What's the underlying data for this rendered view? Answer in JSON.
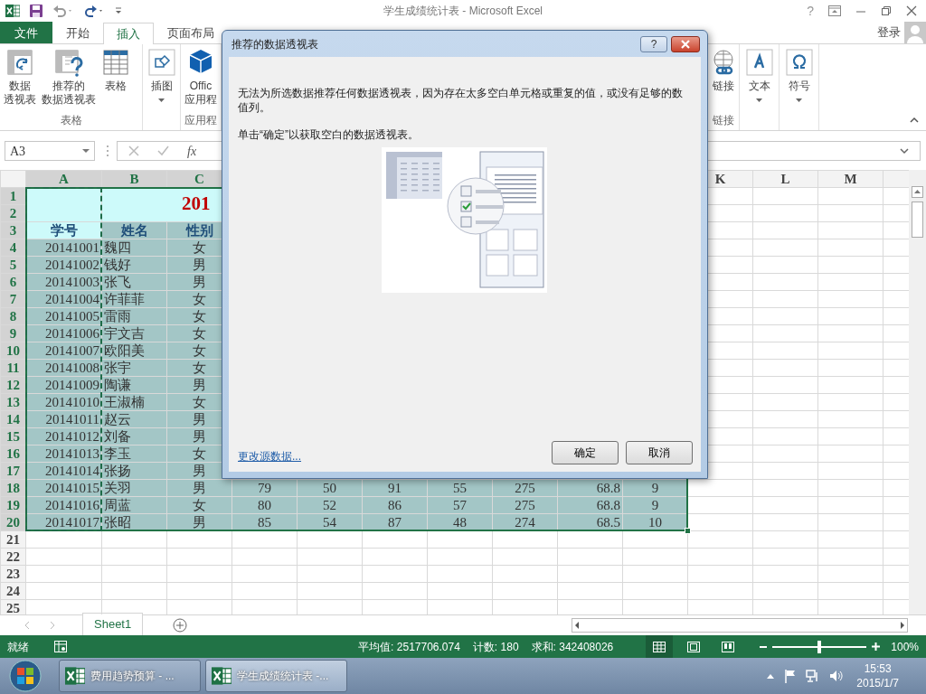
{
  "title_bar": {
    "title": "学生成绩统计表 - Microsoft Excel",
    "help": "?",
    "account": "登录"
  },
  "ribbon_tabs": [
    {
      "label": "文件",
      "kind": "file",
      "selected": false
    },
    {
      "label": "开始",
      "kind": "tab",
      "selected": false
    },
    {
      "label": "插入",
      "kind": "tab",
      "selected": true
    },
    {
      "label": "页面布局",
      "kind": "tab",
      "selected": false
    }
  ],
  "ribbon_groups": [
    {
      "label": "表格",
      "buttons": [
        {
          "lines": [
            "数据",
            "透视表"
          ],
          "dropdown": false
        },
        {
          "lines": [
            "推荐的",
            "数据透视表"
          ],
          "dropdown": false
        },
        {
          "lines": [
            "表格"
          ],
          "dropdown": false
        }
      ]
    },
    {
      "buttons": [
        {
          "lines": [
            "插图"
          ],
          "dropdown": true
        }
      ]
    },
    {
      "label": "应用程",
      "buttons": [
        {
          "lines": [
            "Offic",
            "应用程"
          ],
          "dropdown": false
        }
      ]
    },
    {
      "label": "链接",
      "buttons": [
        {
          "lines": [
            "链接"
          ],
          "dropdown": false
        }
      ]
    },
    {
      "buttons": [
        {
          "lines": [
            "文本"
          ],
          "dropdown": true
        }
      ]
    },
    {
      "buttons": [
        {
          "lines": [
            "符号"
          ],
          "dropdown": true
        }
      ]
    }
  ],
  "formula_bar": {
    "name_box": "A3",
    "function_label": "fx"
  },
  "columns": [
    {
      "label": "A",
      "selected": true
    },
    {
      "label": "B",
      "selected": true
    },
    {
      "label": "C",
      "selected": true
    },
    {
      "label": "K",
      "selected": false
    },
    {
      "label": "L",
      "selected": false
    },
    {
      "label": "M",
      "selected": false
    }
  ],
  "row_headers": [
    {
      "label": "1",
      "selected": true
    },
    {
      "label": "2",
      "selected": true
    },
    {
      "label": "3",
      "selected": true
    },
    {
      "label": "4",
      "selected": true
    },
    {
      "label": "5",
      "selected": true
    },
    {
      "label": "6",
      "selected": true
    },
    {
      "label": "7",
      "selected": true
    },
    {
      "label": "8",
      "selected": true
    },
    {
      "label": "9",
      "selected": true
    },
    {
      "label": "10",
      "selected": true
    },
    {
      "label": "11",
      "selected": true
    },
    {
      "label": "12",
      "selected": true
    },
    {
      "label": "13",
      "selected": true
    },
    {
      "label": "14",
      "selected": true
    },
    {
      "label": "15",
      "selected": true
    },
    {
      "label": "16",
      "selected": true
    },
    {
      "label": "17",
      "selected": true
    },
    {
      "label": "18",
      "selected": true
    },
    {
      "label": "19",
      "selected": true
    },
    {
      "label": "20",
      "selected": true
    },
    {
      "label": "21",
      "selected": false
    },
    {
      "label": "22",
      "selected": false
    },
    {
      "label": "23",
      "selected": false
    },
    {
      "label": "24",
      "selected": false
    },
    {
      "label": "25",
      "selected": false
    }
  ],
  "sheet": {
    "title_text": "201",
    "header": [
      "学号",
      "姓名",
      "性别"
    ],
    "rows": [
      [
        "20141001",
        "魏四",
        "女"
      ],
      [
        "20141002",
        "钱好",
        "男"
      ],
      [
        "20141003",
        "张飞",
        "男"
      ],
      [
        "20141004",
        "许菲菲",
        "女"
      ],
      [
        "20141005",
        "雷雨",
        "女"
      ],
      [
        "20141006",
        "宇文吉",
        "女"
      ],
      [
        "20141007",
        "欧阳美",
        "女"
      ],
      [
        "20141008",
        "张宇",
        "女"
      ],
      [
        "20141009",
        "陶谦",
        "男"
      ],
      [
        "20141010",
        "王淑楠",
        "女"
      ],
      [
        "20141011",
        "赵云",
        "男"
      ],
      [
        "20141012",
        "刘备",
        "男"
      ],
      [
        "20141013",
        "李玉",
        "女"
      ],
      [
        "20141014",
        "张扬",
        "男"
      ],
      [
        "20141015",
        "关羽",
        "男",
        "79",
        "50",
        "91",
        "55",
        "275",
        "68.8",
        "9"
      ],
      [
        "20141016",
        "周蓝",
        "女",
        "80",
        "52",
        "86",
        "57",
        "275",
        "68.8",
        "9"
      ],
      [
        "20141017",
        "张昭",
        "男",
        "85",
        "54",
        "87",
        "48",
        "274",
        "68.5",
        "10"
      ]
    ]
  },
  "sheet_tabs": [
    {
      "label": "Sheet1",
      "selected": true
    }
  ],
  "status_bar": {
    "status": "就绪",
    "stats": [
      "平均值: 2517706.074",
      "计数: 180",
      "求和: 342408026"
    ],
    "views": [
      {
        "kind": "normal",
        "selected": true
      },
      {
        "kind": "page_layout",
        "selected": false
      },
      {
        "kind": "page_break",
        "selected": false
      }
    ],
    "zoom": {
      "level": 0.5,
      "label": "100%"
    }
  },
  "taskbar": {
    "buttons": [
      {
        "label": "费用趋势预算 - ...",
        "selected": false
      },
      {
        "label": "学生成绩统计表 -...",
        "selected": true
      }
    ],
    "time": "15:53",
    "date": "2015/1/7"
  },
  "dialog": {
    "title": "推荐的数据透视表",
    "help": "?",
    "message": "无法为所选数据推荐任何数据透视表，因为存在太多空白单元格或重复的值，或没有足够的数值列。",
    "hint": "单击“确定”以获取空白的数据透视表。",
    "link": "更改源数据...",
    "buttons": [
      "确定",
      "取消"
    ]
  }
}
